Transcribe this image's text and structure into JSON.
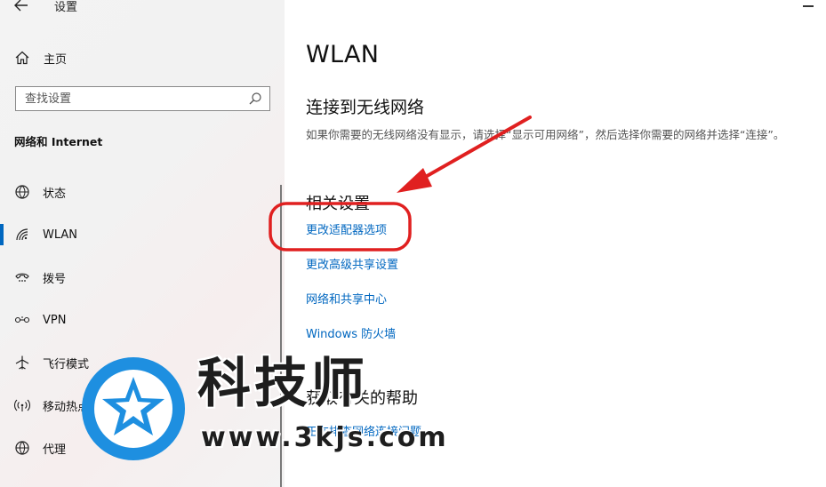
{
  "window": {
    "title": "设置"
  },
  "sidebar": {
    "home_label": "主页",
    "search": {
      "placeholder": "查找设置",
      "value": ""
    },
    "section_title": "网络和 Internet",
    "items": [
      {
        "label": "状态",
        "icon": "globe-status-icon",
        "active": false
      },
      {
        "label": "WLAN",
        "icon": "wifi-icon",
        "active": true
      },
      {
        "label": "拨号",
        "icon": "phone-icon",
        "active": false
      },
      {
        "label": "VPN",
        "icon": "vpn-icon",
        "active": false
      },
      {
        "label": "飞行模式",
        "icon": "airplane-icon",
        "active": false
      },
      {
        "label": "移动热点",
        "icon": "hotspot-icon",
        "active": false
      },
      {
        "label": "代理",
        "icon": "globe-icon",
        "active": false
      }
    ]
  },
  "main": {
    "title": "WLAN",
    "connect_heading": "连接到无线网络",
    "connect_description": "如果你需要的无线网络没有显示，请选择“显示可用网络”，然后选择你需要的网络并选择“连接”。",
    "related_heading": "相关设置",
    "related_links": [
      "更改适配器选项",
      "更改高级共享设置",
      "网络和共享中心",
      "Windows 防火墙"
    ],
    "help_heading": "获取有关的帮助",
    "help_link": "正在排查网络连接问题"
  },
  "annotation": {
    "color": "#e02020"
  },
  "watermark": {
    "text": "科技师",
    "url": "www.3kjs.com",
    "color": "#1e8fe0"
  },
  "colors": {
    "accent": "#0067c0",
    "sidebar_bg": "#f3f3f3"
  }
}
